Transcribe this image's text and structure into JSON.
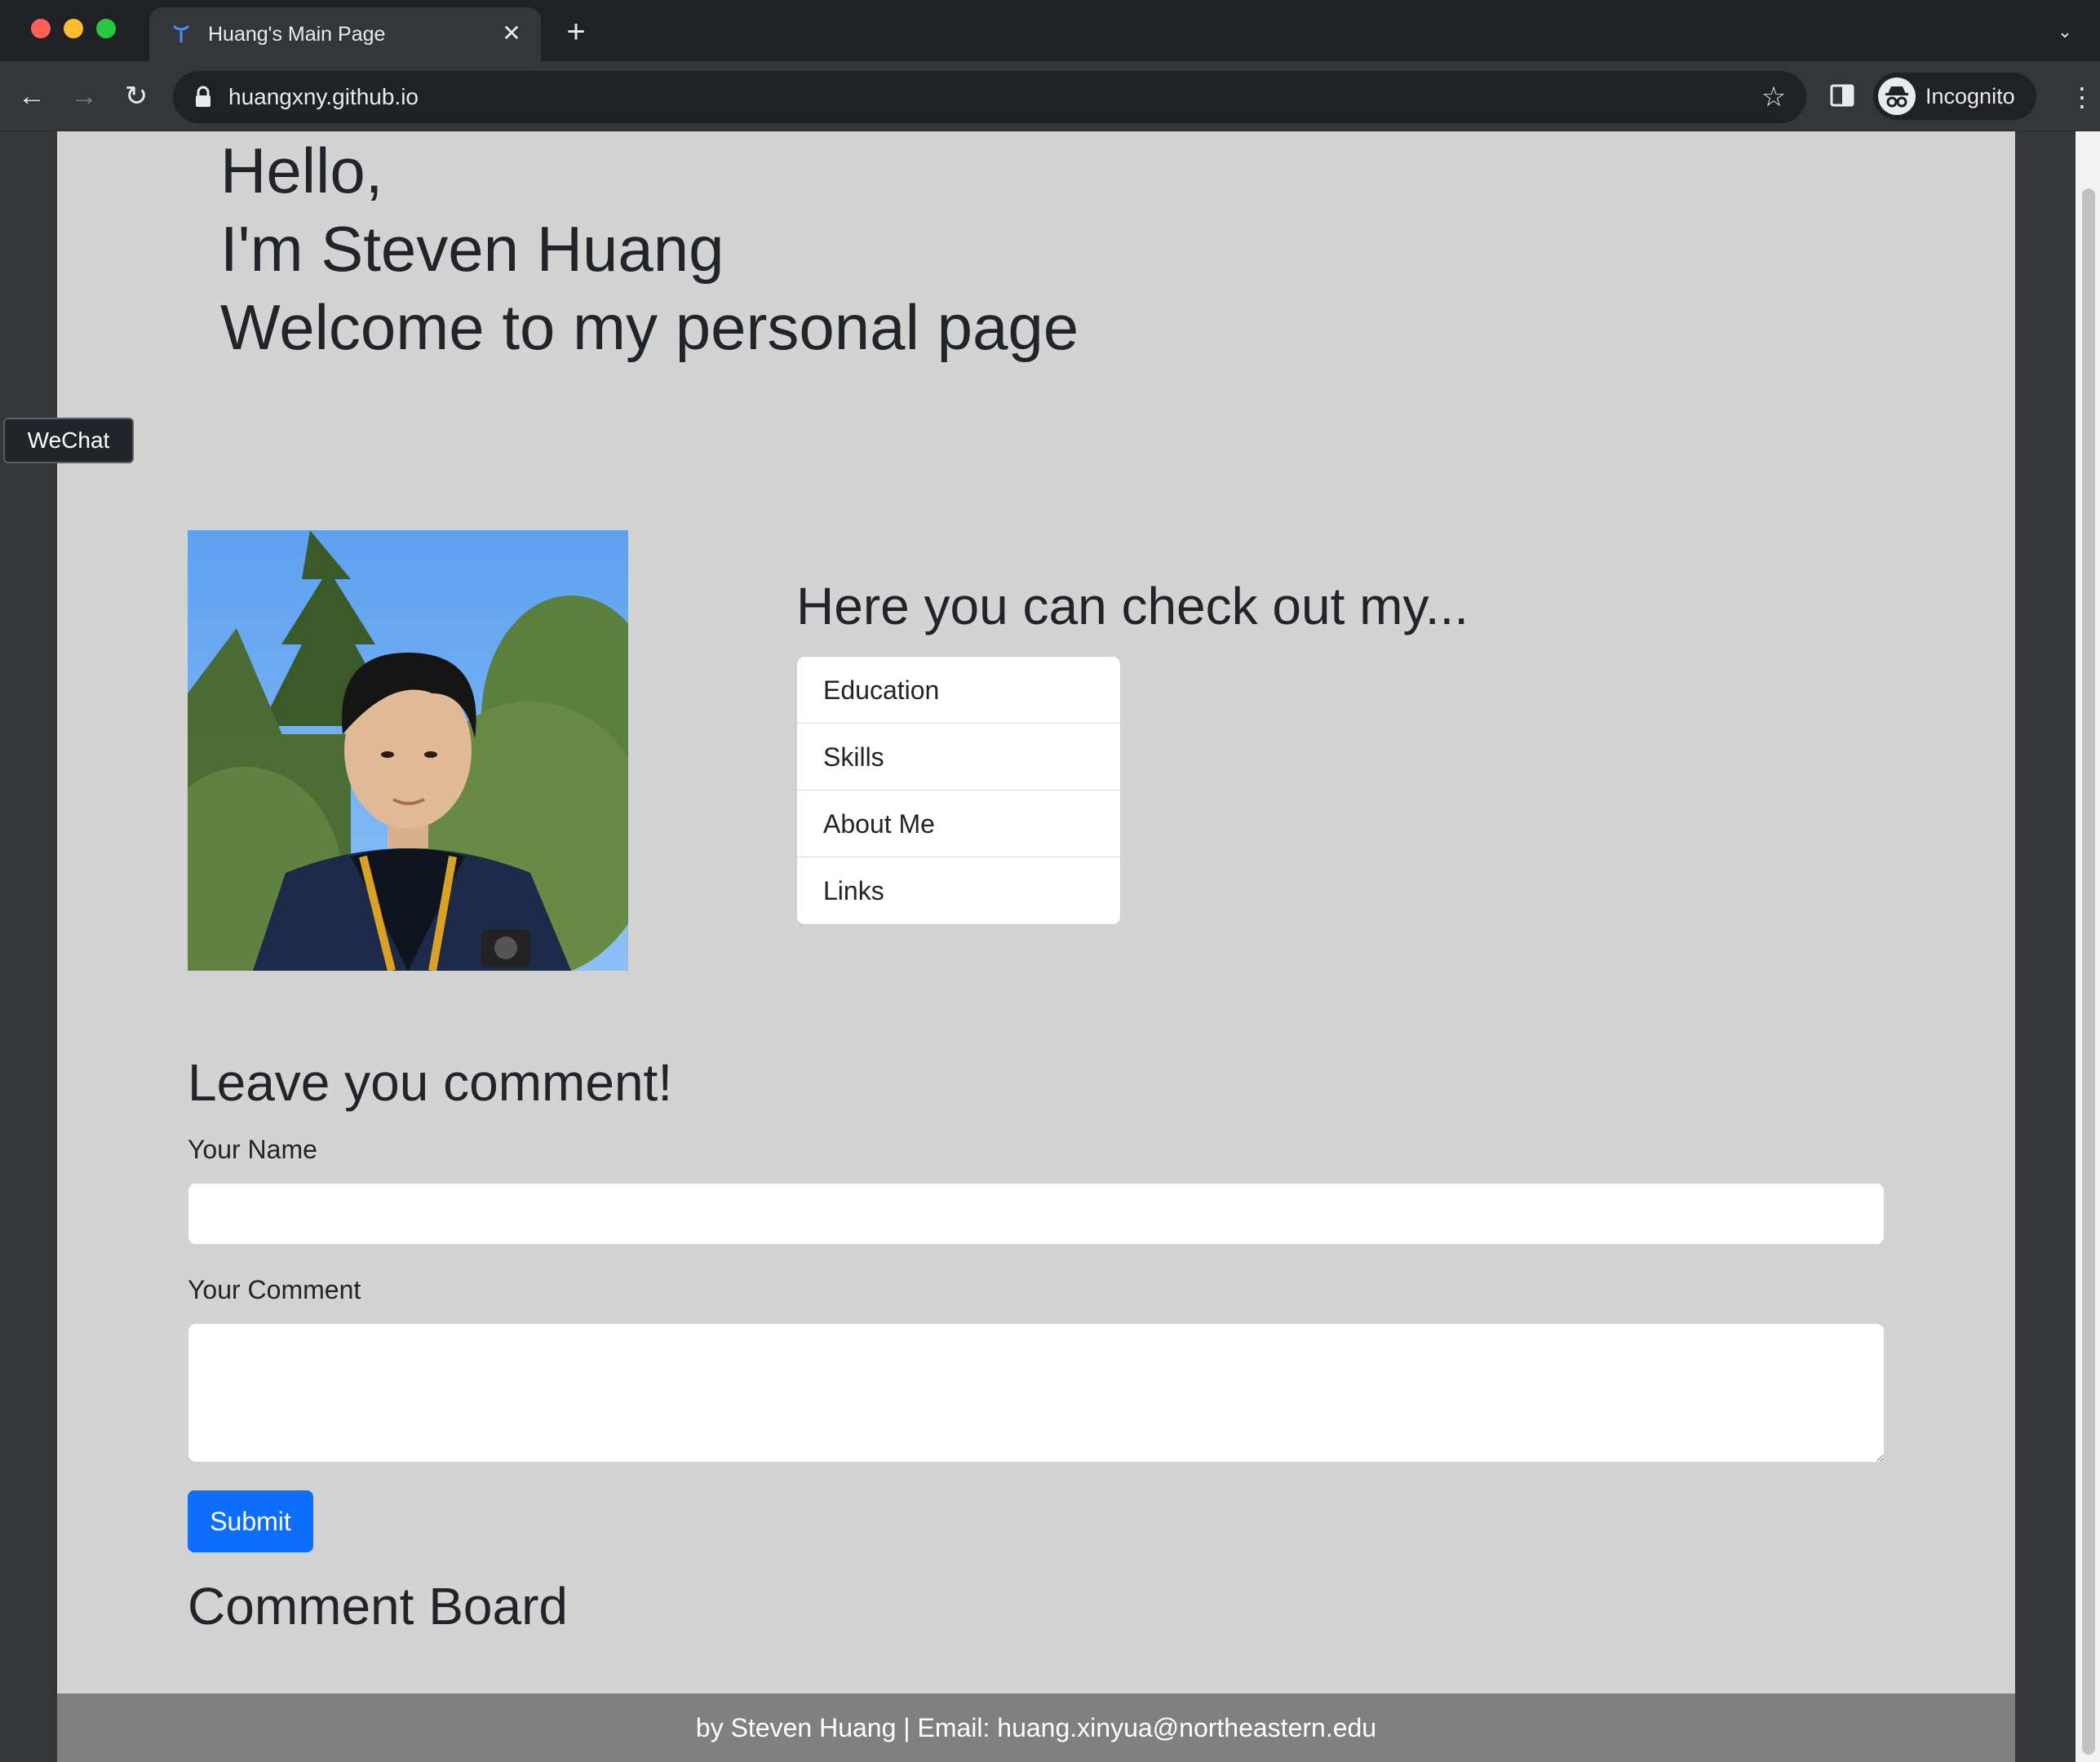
{
  "browser": {
    "tab_title": "Huang's Main Page",
    "url": "huangxny.github.io",
    "profile_label": "Incognito",
    "icons": {
      "favicon": "github-favicon-icon",
      "close": "close-icon",
      "new_tab": "plus-icon",
      "tab_list": "chevron-down-icon",
      "back": "arrow-left-icon",
      "forward": "arrow-right-icon",
      "reload": "reload-icon",
      "lock": "lock-icon",
      "bookmark": "star-icon",
      "side_panel": "side-panel-icon",
      "profile": "incognito-icon",
      "menu": "kebab-menu-icon"
    }
  },
  "hero": {
    "line1": "Hello,",
    "line2": "I'm Steven Huang",
    "line3": "Welcome to my personal page"
  },
  "wechat": {
    "label": "WeChat"
  },
  "nav": {
    "title": "Here you can check out my...",
    "items": [
      {
        "label": "Education"
      },
      {
        "label": "Skills"
      },
      {
        "label": "About Me"
      },
      {
        "label": "Links"
      }
    ]
  },
  "comment_form": {
    "title": "Leave you comment!",
    "name_label": "Your Name",
    "name_value": "",
    "comment_label": "Your Comment",
    "comment_value": "",
    "submit_label": "Submit"
  },
  "board": {
    "title": "Comment Board"
  },
  "footer": {
    "text": "by Steven Huang | Email: huang.xinyua@northeastern.edu"
  },
  "colors": {
    "page_background": "#d3d3d3",
    "primary_button": "#0d6efd",
    "footer_background": "#808080",
    "browser_frame": "#202124"
  }
}
